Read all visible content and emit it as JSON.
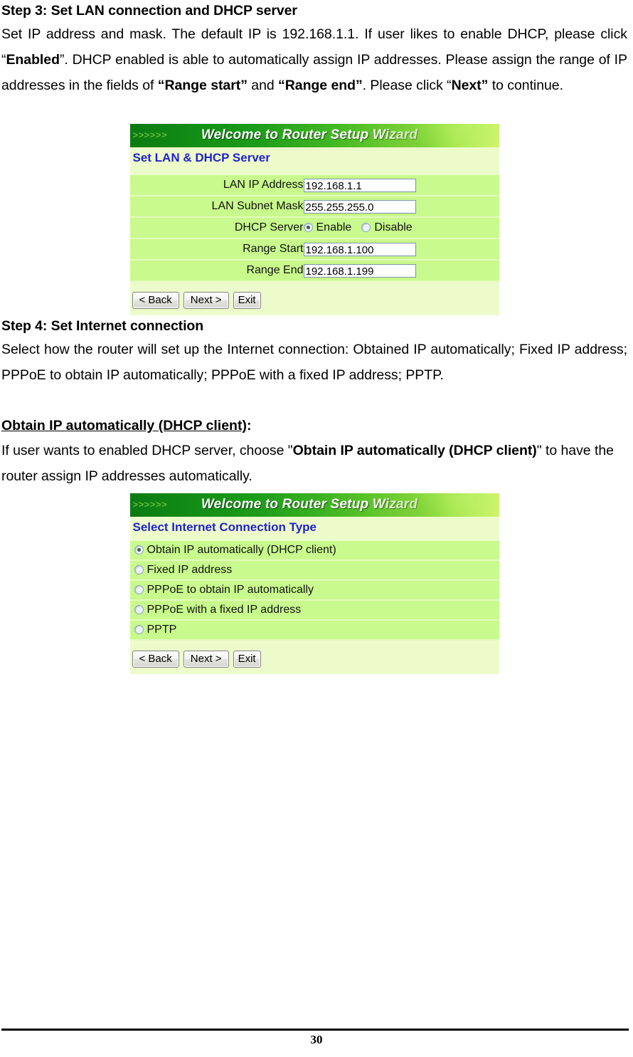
{
  "document": {
    "page_number": "30",
    "step3": {
      "heading": "Step 3: Set LAN connection and DHCP server",
      "para_parts": {
        "p1": "Set IP address and mask.  The default IP is 192.168.1.1.  If user likes to enable DHCP, please click “",
        "b1": "Enabled",
        "p2": "”.  DHCP enabled is able to automatically assign IP addresses.  Please assign the range of IP addresses in the fields of ",
        "b2": "“Range start”",
        "p3": " and ",
        "b3": "“Range end”",
        "p4": ".  Please click “",
        "b4": "Next”",
        "p5": " to continue."
      }
    },
    "step4": {
      "heading": "Step 4: Set Internet connection",
      "paragraph": "Select how the router will set up the Internet connection: Obtained IP automatically; Fixed IP address; PPPoE to obtain IP automatically; PPPoE with a fixed IP address; PPTP."
    },
    "obtain_section": {
      "heading_underlined": "Obtain IP automatically (DHCP client)",
      "heading_tail": ":",
      "para_parts": {
        "p1": "If user wants to enabled DHCP server, choose \"",
        "b1": "Obtain IP automatically (DHCP client)",
        "p2": "\" to have the router assign IP addresses automatically."
      }
    }
  },
  "wizard_lan": {
    "banner": {
      "chevrons": ">>>>>>",
      "title": "Welcome to Router Setup Wizard"
    },
    "subtitle": "Set LAN & DHCP Server",
    "fields": [
      {
        "label": "LAN IP Address",
        "value": "192.168.1.1",
        "type": "text"
      },
      {
        "label": "LAN Subnet Mask",
        "value": "255.255.255.0",
        "type": "text"
      },
      {
        "label": "DHCP Server",
        "type": "radio",
        "options": [
          {
            "label": "Enable",
            "selected": true
          },
          {
            "label": "Disable",
            "selected": false
          }
        ]
      },
      {
        "label": "Range Start",
        "value": "192.168.1.100",
        "type": "text"
      },
      {
        "label": "Range End",
        "value": "192.168.1.199",
        "type": "text"
      }
    ],
    "buttons": {
      "back": "< Back",
      "next": "Next >",
      "exit": "Exit"
    }
  },
  "wizard_wan": {
    "banner": {
      "chevrons": ">>>>>>",
      "title": "Welcome to Router Setup Wizard"
    },
    "subtitle": "Select Internet Connection Type",
    "options": [
      {
        "label": "Obtain IP automatically (DHCP client)",
        "selected": true
      },
      {
        "label": "Fixed IP address",
        "selected": false
      },
      {
        "label": "PPPoE to obtain IP automatically",
        "selected": false
      },
      {
        "label": "PPPoE with a fixed IP address",
        "selected": false
      },
      {
        "label": "PPTP",
        "selected": false
      }
    ],
    "buttons": {
      "back": "< Back",
      "next": "Next >",
      "exit": "Exit"
    }
  },
  "colors": {
    "panel_bg": "#edfbcb",
    "row_bg": "#c8fa8d",
    "subtitle": "#2222cc",
    "banner_dark": "#0b7a12",
    "banner_light": "#d2f36d"
  }
}
